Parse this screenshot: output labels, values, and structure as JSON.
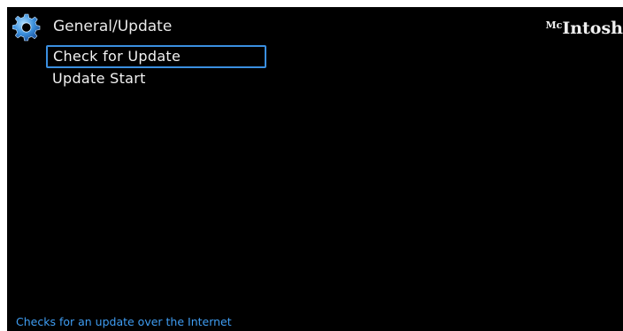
{
  "header": {
    "icon": "gear-icon",
    "title": "General/Update",
    "brand_prefix": "Mc",
    "brand_name": "Intosh"
  },
  "menu": {
    "items": [
      {
        "label": "Check for Update",
        "selected": true
      },
      {
        "label": "Update Start",
        "selected": false
      }
    ]
  },
  "footer": {
    "hint": "Checks for an update over the Internet"
  },
  "colors": {
    "background": "#000000",
    "text": "#f2f2f2",
    "accent": "#3a8fe0",
    "hint_text": "#3f9df2"
  }
}
